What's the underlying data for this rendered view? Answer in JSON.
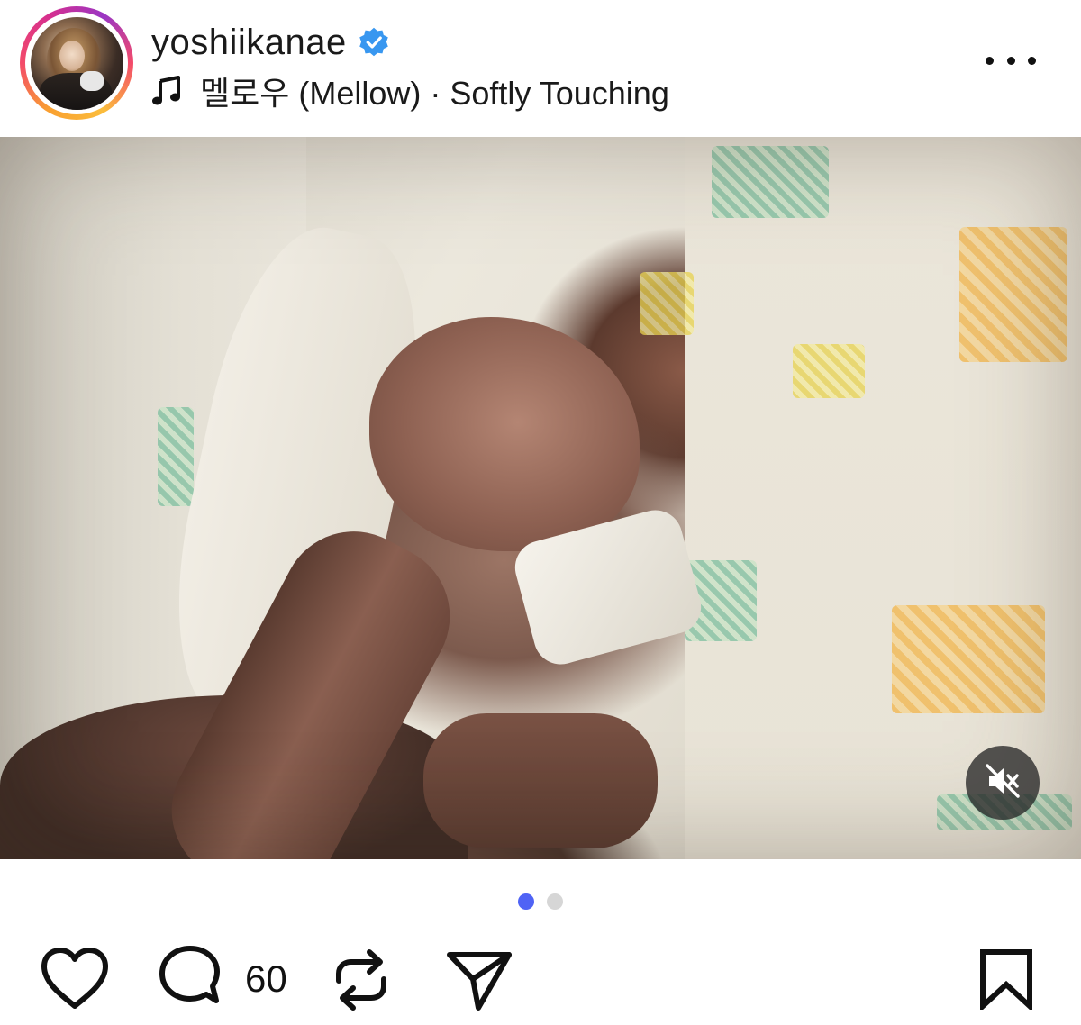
{
  "post": {
    "username": "yoshiikanae",
    "verified": true,
    "music": {
      "icon": "music-note-icon",
      "text": "멜로우 (Mellow) · Softly Touching"
    }
  },
  "media": {
    "description_icon": "mute-icon",
    "page_count": 2,
    "active_page": 1
  },
  "actions": {
    "like_icon": "heart-icon",
    "comment_icon": "comment-icon",
    "comment_count": "60",
    "repost_icon": "repost-icon",
    "share_icon": "share-icon",
    "save_icon": "bookmark-icon"
  },
  "colors": {
    "verified_badge": "#3897f0",
    "active_dot": "#4f63f5",
    "inactive_dot": "#d6d6d6",
    "text": "#111111"
  }
}
